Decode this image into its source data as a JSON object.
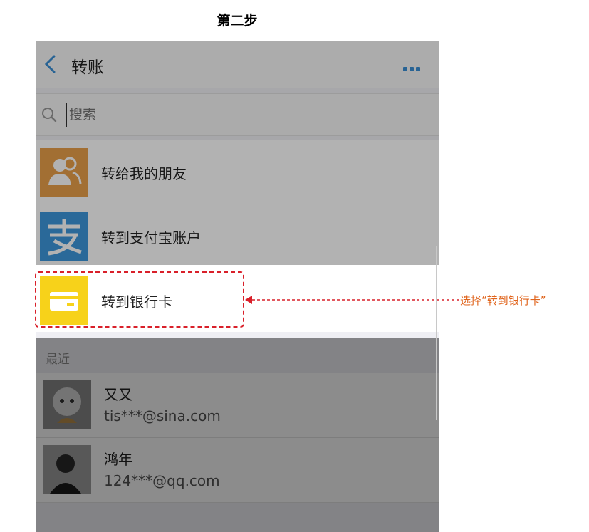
{
  "step_title": "第二步",
  "nav": {
    "title": "转账",
    "back_icon": "chevron-left-icon",
    "more_icon": "more-dots-icon",
    "accent_color": "#3a8ed4"
  },
  "search": {
    "placeholder": "搜索",
    "value": ""
  },
  "menu": {
    "items": [
      {
        "label": "转给我的朋友",
        "icon": "friends-icon",
        "color": "#e9a04a"
      },
      {
        "label": "转到支付宝账户",
        "icon": "alipay-icon",
        "color": "#3d97db"
      },
      {
        "label": "转到银行卡",
        "icon": "bank-card-icon",
        "color": "#f7d21a"
      }
    ]
  },
  "recent": {
    "header": "最近",
    "contacts": [
      {
        "name": "又又",
        "email": "tis***@sina.com"
      },
      {
        "name": "鸿年",
        "email": "124***@qq.com"
      }
    ]
  },
  "annotation": {
    "text": "选择“转到银行卡”",
    "color": "#e0641c",
    "highlight_color": "#d9202a"
  }
}
